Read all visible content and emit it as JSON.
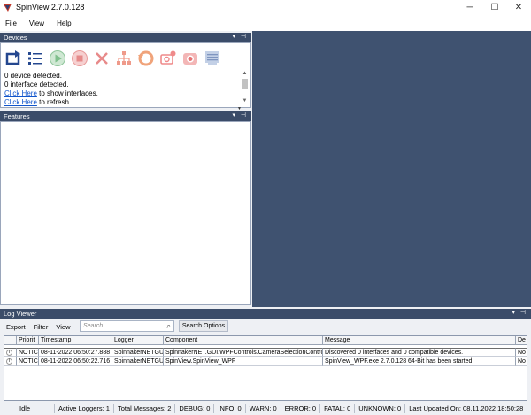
{
  "window": {
    "title": "SpinView 2.7.0.128",
    "controls": {
      "minimize": "─",
      "maximize": "☐",
      "close": "✕"
    }
  },
  "menu": [
    "File",
    "View",
    "Help"
  ],
  "devices_panel": {
    "title": "Devices",
    "header_controls": "▾ ⊣",
    "toolbar_icons": [
      "switch-view-icon",
      "list-view-icon",
      "play-icon",
      "stop-icon",
      "disconnect-icon",
      "network-icon",
      "recording-icon",
      "snapshot-icon",
      "camera-record-icon",
      "settings-panel-icon"
    ],
    "status_device": "0 device detected.",
    "status_interface": "0 interface detected.",
    "link_interfaces": "Click Here",
    "text_interfaces": " to show interfaces.",
    "link_refresh": "Click Here",
    "text_refresh": " to refresh."
  },
  "features_panel": {
    "title": "Features",
    "header_controls": "▾ ⊣"
  },
  "log_viewer": {
    "title": "Log Viewer",
    "header_controls": "▾ ⊣",
    "toolbar": {
      "export": "Export",
      "filter": "Filter",
      "view": "View"
    },
    "search_placeholder": "Search",
    "search_options": "Search Options",
    "columns": [
      "",
      "Priorit",
      "Timestamp",
      "Logger",
      "Component",
      "Message",
      "De"
    ],
    "rows": [
      {
        "icon": "i",
        "priority": "NOTICE",
        "timestamp": "08-11-2022 06:50:27.888",
        "logger": "SpinnakerNETGUI",
        "component": "SpinnakerNET.GUI.WPFControls.CameraSelectionControl",
        "message": "Discovered 0 interfaces and 0 compatible devices.",
        "detail": "No"
      },
      {
        "icon": "i",
        "priority": "NOTICE",
        "timestamp": "08-11-2022 06:50:22.716",
        "logger": "SpinnakerNETGUI",
        "component": "SpinView.SpinView_WPF",
        "message": "SpinView_WPF.exe 2.7.0.128 64-Bit has been started.",
        "detail": "No"
      }
    ]
  },
  "status_bar": {
    "state": "Idle",
    "active_loggers": "Active Loggers: 1",
    "total_messages": "Total Messages: 2",
    "debug": "DEBUG: 0",
    "info": "INFO: 0",
    "warn": "WARN: 0",
    "error": "ERROR: 0",
    "fatal": "FATAL: 0",
    "unknown": "UNKNOWN: 0",
    "last_updated": "Last Updated On: 08.11.2022 18:50:28"
  },
  "colors": {
    "workspace": "#3f5270",
    "panel_header": "#3b4c69",
    "link": "#1155cc"
  }
}
